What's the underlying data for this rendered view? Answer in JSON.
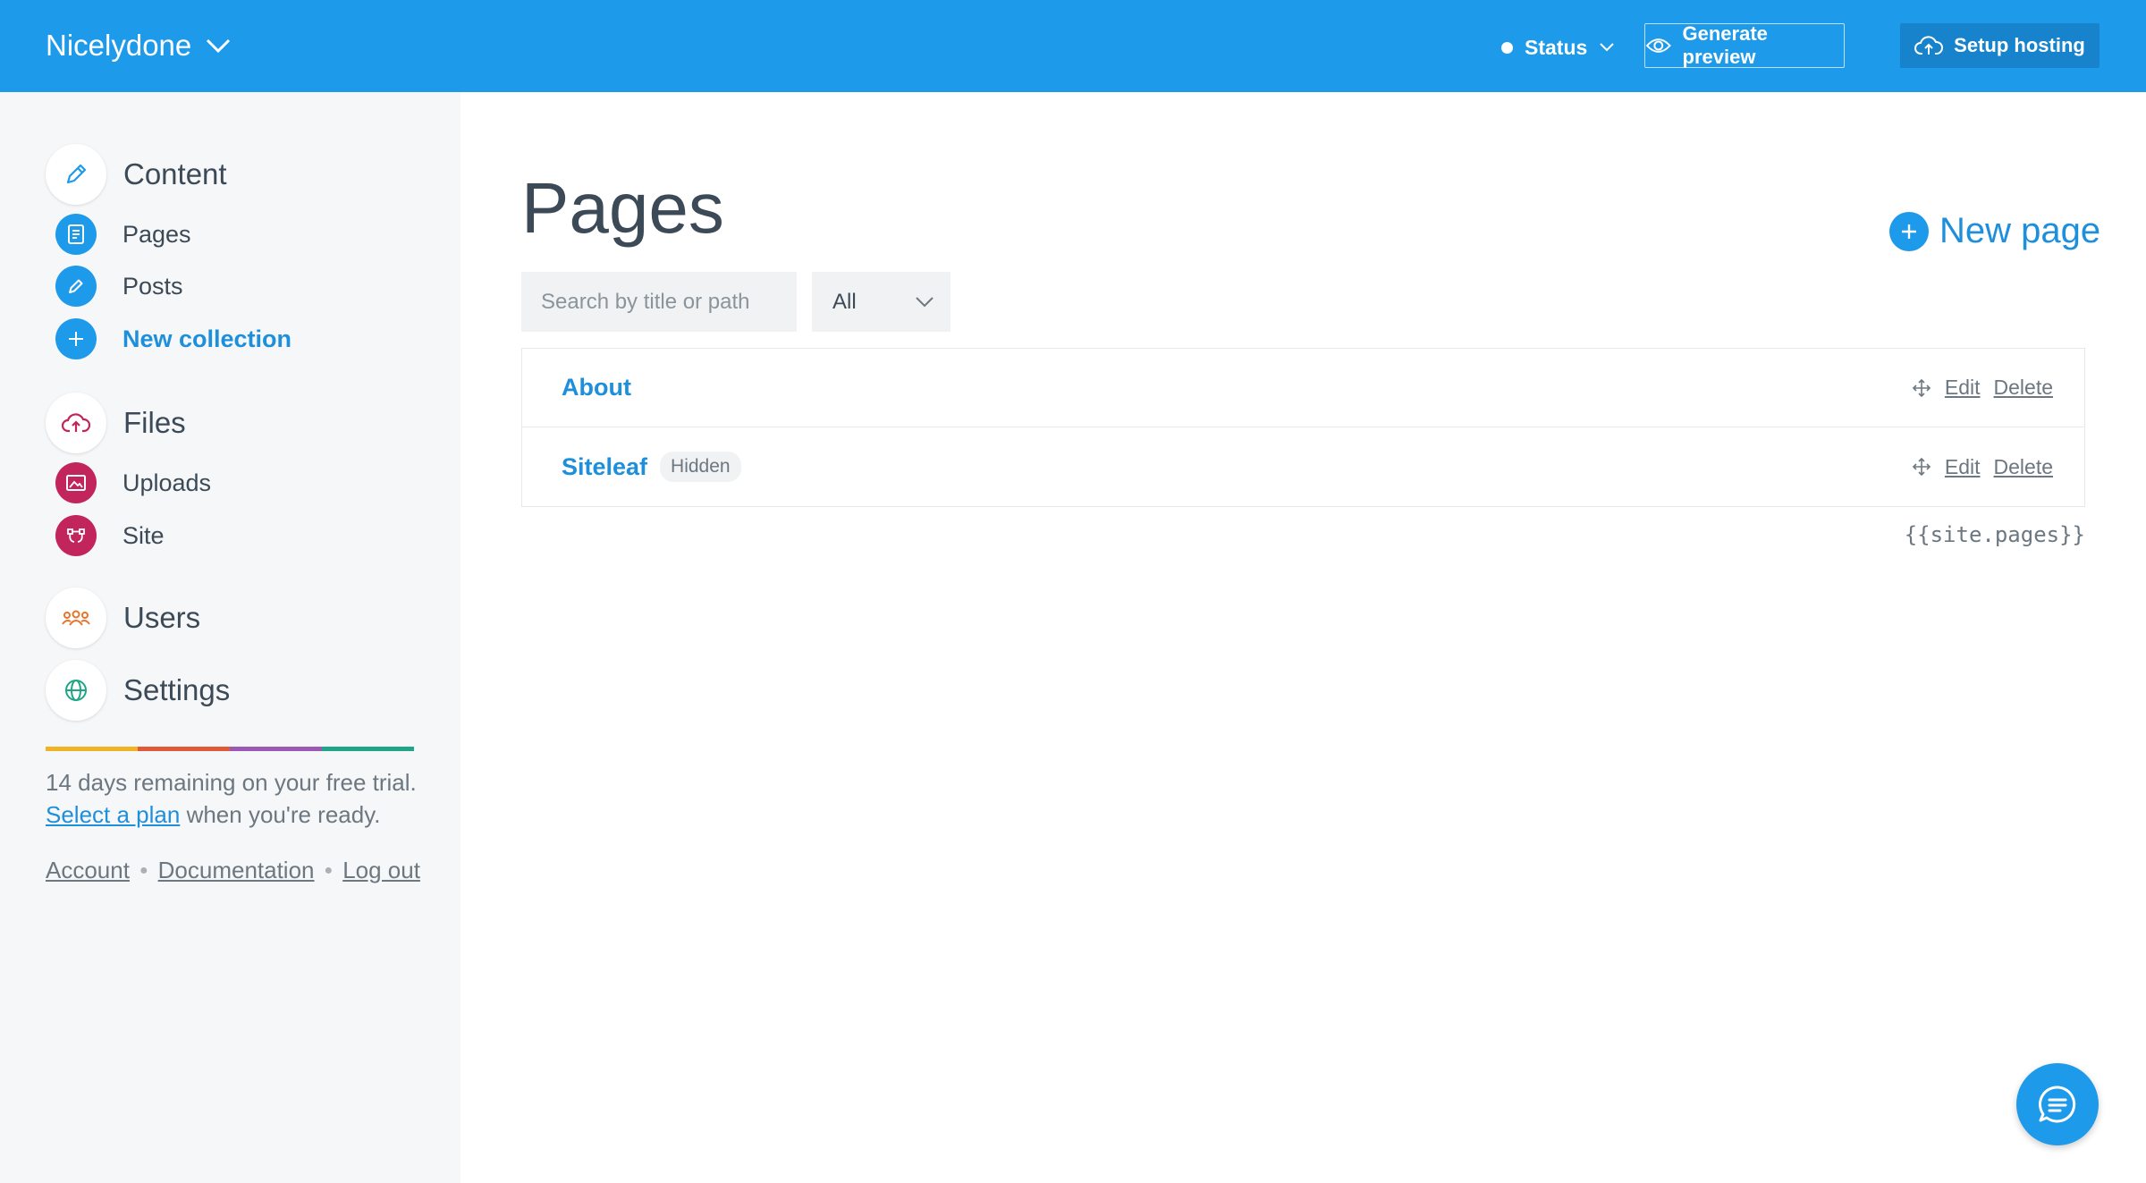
{
  "header": {
    "site_name": "Nicelydone",
    "status_label": "Status",
    "preview_label": "Generate preview",
    "hosting_label": "Setup hosting"
  },
  "sidebar": {
    "content": {
      "label": "Content",
      "items": [
        {
          "label": "Pages"
        },
        {
          "label": "Posts"
        },
        {
          "label": "New collection"
        }
      ]
    },
    "files": {
      "label": "Files",
      "items": [
        {
          "label": "Uploads"
        },
        {
          "label": "Site"
        }
      ]
    },
    "users_label": "Users",
    "settings_label": "Settings",
    "trial_text": "14 days remaining on your free trial.",
    "select_plan": "Select a plan",
    "when_ready": "when you're ready.",
    "links": {
      "account": "Account",
      "documentation": "Documentation",
      "logout": "Log out"
    }
  },
  "main": {
    "title": "Pages",
    "new_page": "New page",
    "search_placeholder": "Search by title or path",
    "filter_value": "All",
    "rows": [
      {
        "title": "About",
        "badge": "",
        "edit": "Edit",
        "delete": "Delete"
      },
      {
        "title": "Siteleaf",
        "badge": "Hidden",
        "edit": "Edit",
        "delete": "Delete"
      }
    ],
    "liquid_tag": "{{site.pages}}"
  },
  "colors": {
    "header_bg": "#1e9aeb",
    "accent": "#1e8fdb",
    "files_icon": "#c2255c",
    "users_icon": "#e8742c",
    "settings_icon": "#1fa687"
  }
}
